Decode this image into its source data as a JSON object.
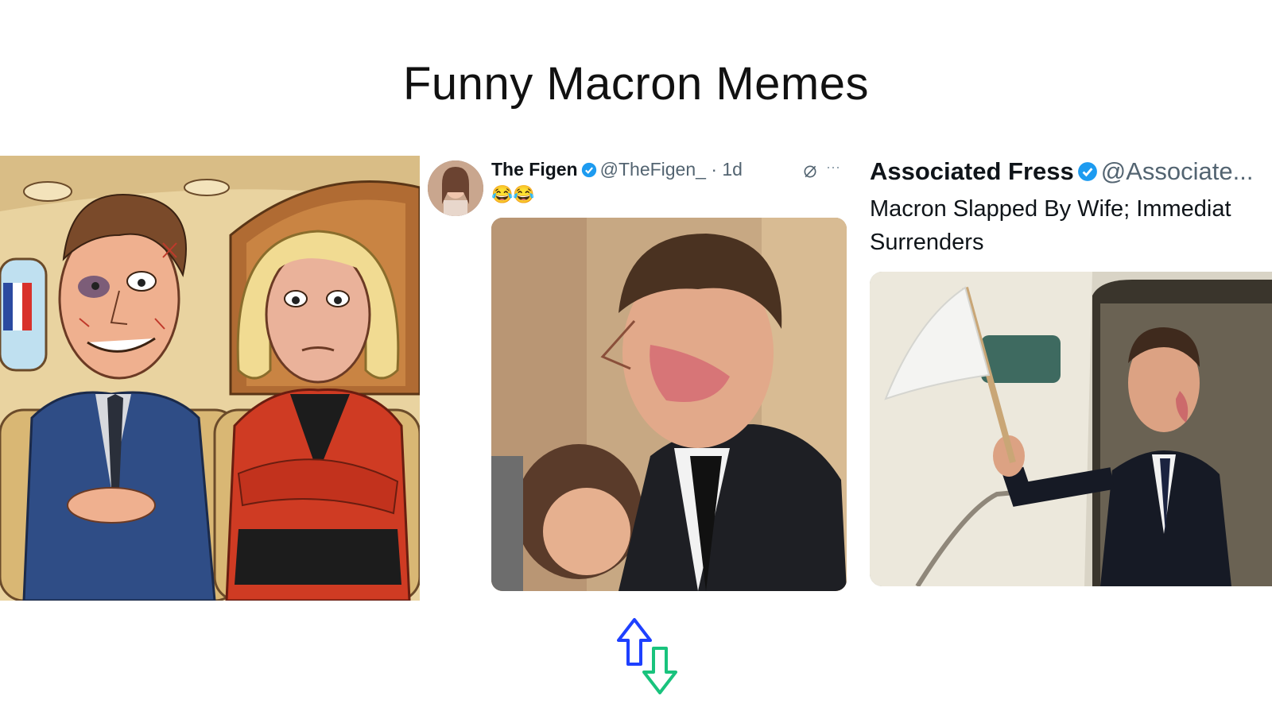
{
  "title": "Funny Macron Memes",
  "cartoon_panel": {
    "description_icon": "cartoon-couple-on-plane-icon"
  },
  "tweet_figen": {
    "name": "The Figen",
    "handle": "@TheFigen_",
    "time": "· 1d",
    "emoji": "😂😂",
    "more": "···"
  },
  "tweet_fress": {
    "name": "Associated Fress",
    "handle": "@Associate...",
    "text_line1": "Macron Slapped By Wife; Immediat",
    "text_line2": "Surrenders"
  },
  "colors": {
    "verified": "#1d9bf0",
    "logo_blue": "#1e40ff",
    "logo_green": "#19c37d"
  }
}
